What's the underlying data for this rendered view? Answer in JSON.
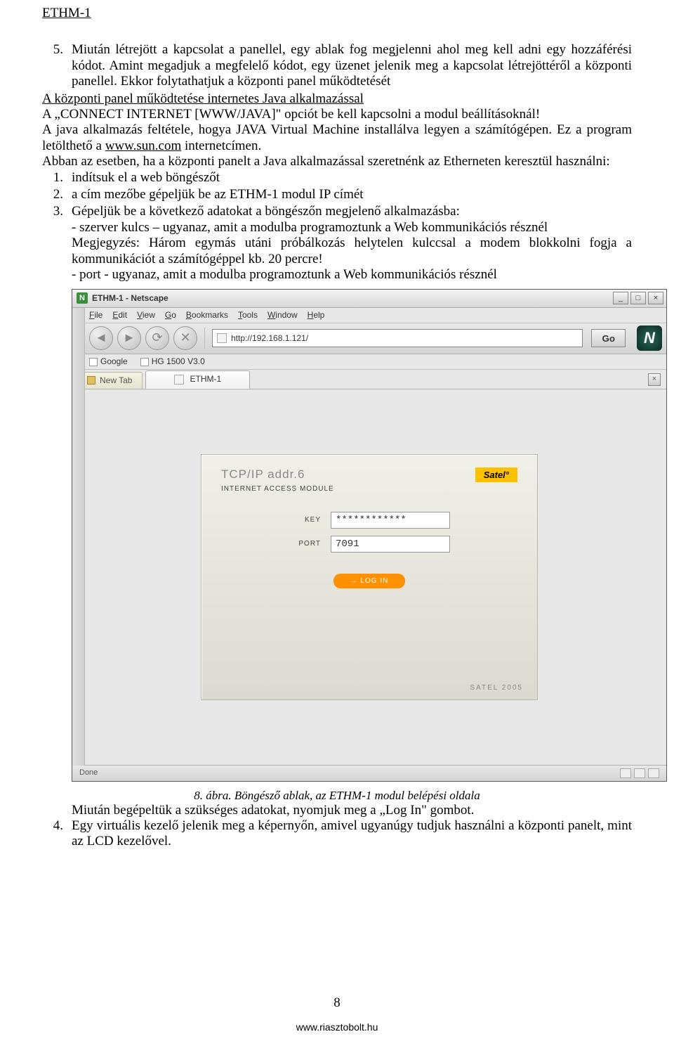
{
  "doc_title": "ETHM-1",
  "body": {
    "item5_num": "5.",
    "item5_text": "Miután létrejött a kapcsolat a panellel, egy ablak fog megjelenni ahol meg kell adni egy hozzáférési kódot. Amint megadjuk a megfelelő kódot, egy üzenet jelenik meg a kapcsolat létrejöttéről a központi panellel. Ekkor folytathatjuk a központi panel működtetését",
    "heading_java": "A központi panel működtetése internetes Java alkalmazással",
    "para_java_1": "A „CONNECT INTERNET [WWW/JAVA]\" opciót be kell kapcsolni a modul beállításoknál!",
    "para_java_2": "A java alkalmazás feltétele, hogya JAVA Virtual Machine installálva legyen a számítógépen. Ez a program letölthető a ",
    "para_java_link": "www.sun.com",
    "para_java_3": " internetcímen.",
    "para_java_4": "Abban az esetben, ha a központi panelt a Java alkalmazással szeretnénk az Etherneten keresztül használni:",
    "sub1_num": "1.",
    "sub1": "indítsuk el a web böngészőt",
    "sub2_num": "2.",
    "sub2": "a cím mezőbe gépeljük be az ETHM-1 modul IP címét",
    "sub3_num": "3.",
    "sub3": "Gépeljük be a következő adatokat a böngészőn megjelenő alkalmazásba:",
    "sub3_line1": "- szerver kulcs – ugyanaz, amit a modulba programoztunk a Web kommunikációs résznél",
    "sub3_line2": "Megjegyzés: Három egymás utáni próbálkozás helytelen kulccsal a modem blokkolni fogja a kommunikációt a számítógéppel kb. 20 percre!",
    "sub3_line3": "- port - ugyanaz, amit a modulba programoztunk a Web kommunikációs résznél",
    "figure_caption": "8. ábra. Böngésző ablak, az ETHM-1 modul belépési oldala",
    "after_fig": "Miután begépeltük a szükséges adatokat, nyomjuk meg a „Log In\" gombot.",
    "item4_num": "4.",
    "item4_text": "Egy virtuális kezelő jelenik meg a képernyőn, amivel ugyanúgy tudjuk használni a központi panelt, mint az LCD kezelővel."
  },
  "browser": {
    "title": "ETHM-1       - Netscape",
    "menu": [
      "File",
      "Edit",
      "View",
      "Go",
      "Bookmarks",
      "Tools",
      "Window",
      "Help"
    ],
    "url": "http://192.168.1.121/",
    "go_label": "Go",
    "bookmarks": [
      "Google",
      "HG 1500 V3.0"
    ],
    "newtab_label": "New Tab",
    "active_tab": "ETHM-1",
    "applet": {
      "title": "TCP/IP addr.6",
      "brand": "Satel°",
      "subtitle": "INTERNET ACCESS MODULE",
      "key_label": "KEY",
      "key_value": "************",
      "port_label": "PORT",
      "port_value": "7091",
      "login_label": "→ LOG IN",
      "footer": "SATEL 2005"
    },
    "status": "Done"
  },
  "page_number": "8",
  "footer_url": "www.riasztobolt.hu"
}
